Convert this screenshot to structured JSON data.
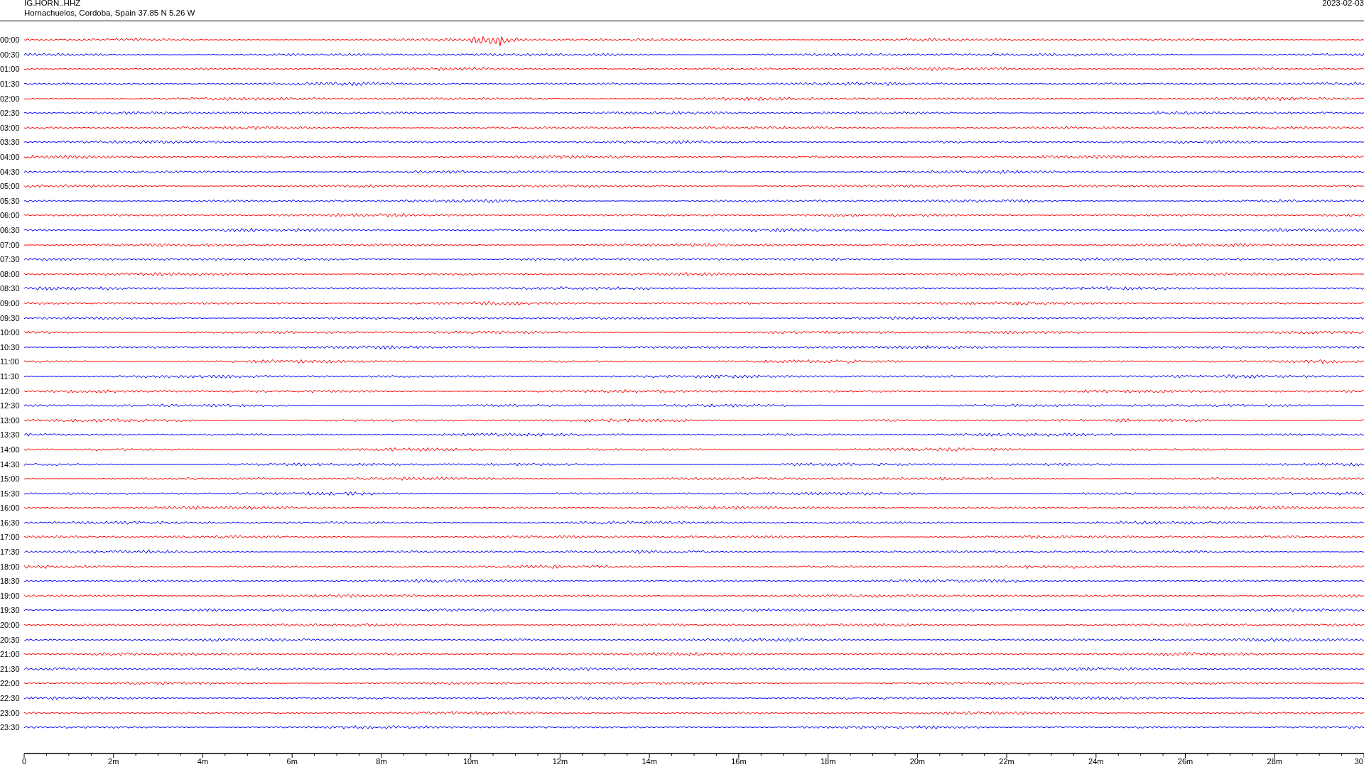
{
  "header": {
    "station": "IG.HORN..HHZ",
    "location": "Hornachuelos, Cordoba, Spain  37.85 N 5.26 W",
    "date": "2023-02-03"
  },
  "rows": [
    {
      "label": "00:00",
      "color": "#ff0000"
    },
    {
      "label": "00:30",
      "color": "#0000ff"
    },
    {
      "label": "01:00",
      "color": "#ff0000"
    },
    {
      "label": "01:30",
      "color": "#0000ff"
    },
    {
      "label": "02:00",
      "color": "#ff0000"
    },
    {
      "label": "02:30",
      "color": "#0000ff"
    },
    {
      "label": "03:00",
      "color": "#ff0000"
    },
    {
      "label": "03:30",
      "color": "#0000ff"
    },
    {
      "label": "04:00",
      "color": "#ff0000"
    },
    {
      "label": "04:30",
      "color": "#0000ff"
    },
    {
      "label": "05:00",
      "color": "#ff0000"
    },
    {
      "label": "05:30",
      "color": "#0000ff"
    },
    {
      "label": "06:00",
      "color": "#ff0000"
    },
    {
      "label": "06:30",
      "color": "#0000ff"
    },
    {
      "label": "07:00",
      "color": "#ff0000"
    },
    {
      "label": "07:30",
      "color": "#0000ff"
    },
    {
      "label": "08:00",
      "color": "#ff0000"
    },
    {
      "label": "08:30",
      "color": "#0000ff"
    },
    {
      "label": "09:00",
      "color": "#ff0000"
    },
    {
      "label": "09:30",
      "color": "#0000ff"
    },
    {
      "label": "10:00",
      "color": "#ff0000"
    },
    {
      "label": "10:30",
      "color": "#0000ff"
    },
    {
      "label": "11:00",
      "color": "#ff0000"
    },
    {
      "label": "11:30",
      "color": "#0000ff"
    },
    {
      "label": "12:00",
      "color": "#ff0000"
    },
    {
      "label": "12:30",
      "color": "#0000ff"
    },
    {
      "label": "13:00",
      "color": "#ff0000"
    },
    {
      "label": "13:30",
      "color": "#0000ff"
    },
    {
      "label": "14:00",
      "color": "#ff0000"
    },
    {
      "label": "14:30",
      "color": "#0000ff"
    },
    {
      "label": "15:00",
      "color": "#ff0000"
    },
    {
      "label": "15:30",
      "color": "#0000ff"
    },
    {
      "label": "16:00",
      "color": "#ff0000"
    },
    {
      "label": "16:30",
      "color": "#0000ff"
    },
    {
      "label": "17:00",
      "color": "#ff0000"
    },
    {
      "label": "17:30",
      "color": "#0000ff"
    },
    {
      "label": "18:00",
      "color": "#ff0000"
    },
    {
      "label": "18:30",
      "color": "#0000ff"
    },
    {
      "label": "19:00",
      "color": "#ff0000"
    },
    {
      "label": "19:30",
      "color": "#0000ff"
    },
    {
      "label": "20:00",
      "color": "#ff0000"
    },
    {
      "label": "20:30",
      "color": "#0000ff"
    },
    {
      "label": "21:00",
      "color": "#ff0000"
    },
    {
      "label": "21:30",
      "color": "#0000ff"
    },
    {
      "label": "22:00",
      "color": "#ff0000"
    },
    {
      "label": "22:30",
      "color": "#0000ff"
    },
    {
      "label": "23:00",
      "color": "#ff0000"
    },
    {
      "label": "23:30",
      "color": "#0000ff"
    }
  ],
  "axis": {
    "tick_labels": [
      "0",
      "2m",
      "4m",
      "6m",
      "8m",
      "10m",
      "12m",
      "14m",
      "16m",
      "18m",
      "20m",
      "22m",
      "24m",
      "26m",
      "28m",
      "30"
    ]
  }
}
